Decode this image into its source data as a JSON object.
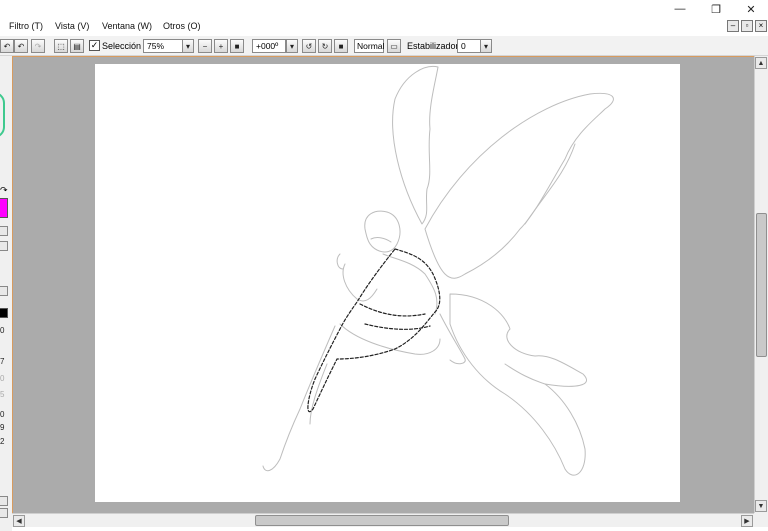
{
  "window": {
    "minimize_glyph": "—",
    "restore_glyph": "❐",
    "close_glyph": "✕"
  },
  "menubar": {
    "items": [
      {
        "label": "Filtro (T)"
      },
      {
        "label": "Vista (V)"
      },
      {
        "label": "Ventana (W)"
      },
      {
        "label": "Otros (O)"
      }
    ]
  },
  "toolbar": {
    "selection_label": "Selección",
    "selection_checked": true,
    "zoom_value": "75%",
    "rotation_value": "+000º",
    "blend_mode_value": "Normal",
    "stabilizer_label": "Estabilizador",
    "stabilizer_value": "0"
  },
  "left_panel": {
    "values": [
      "0",
      "7",
      "0",
      "5",
      "0",
      "9",
      "2"
    ],
    "color_swatch": "#ff00ff"
  },
  "colors": {
    "workarea": "#ababab",
    "canvas": "#ffffff",
    "accent_border": "#d79b5f",
    "swatch": "#ff00ff"
  },
  "icons": [
    "undo-icon",
    "redo-icon",
    "deselect-icon",
    "invert-selection-icon",
    "zoom-out-icon",
    "zoom-in-icon",
    "zoom-reset-icon",
    "rotate-left-icon",
    "rotate-right-icon",
    "rotate-reset-icon",
    "flip-icon"
  ]
}
